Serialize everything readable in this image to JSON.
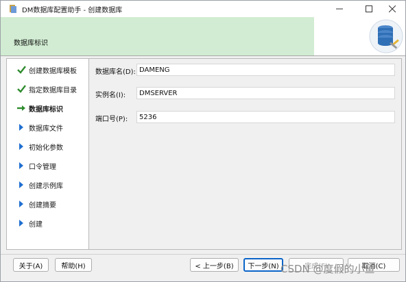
{
  "window": {
    "title": "DM数据库配置助手 - 创建数据库",
    "minimize_icon": "minimize-icon",
    "maximize_icon": "maximize-icon",
    "close_icon": "close-icon"
  },
  "header": {
    "title": "数据库标识",
    "image_icon": "database-config-icon"
  },
  "nav": {
    "items": [
      {
        "label": "创建数据库模板",
        "state": "done",
        "icon": "checkmark-icon"
      },
      {
        "label": "指定数据库目录",
        "state": "done",
        "icon": "checkmark-icon"
      },
      {
        "label": "数据库标识",
        "state": "current",
        "icon": "arrow-right-icon"
      },
      {
        "label": "数据库文件",
        "state": "pending",
        "icon": "triangle-right-icon"
      },
      {
        "label": "初始化参数",
        "state": "pending",
        "icon": "triangle-right-icon"
      },
      {
        "label": "口令管理",
        "state": "pending",
        "icon": "triangle-right-icon"
      },
      {
        "label": "创建示例库",
        "state": "pending",
        "icon": "triangle-right-icon"
      },
      {
        "label": "创建摘要",
        "state": "pending",
        "icon": "triangle-right-icon"
      },
      {
        "label": "创建",
        "state": "pending",
        "icon": "triangle-right-icon"
      }
    ]
  },
  "form": {
    "db_name_label": "数据库名(D):",
    "db_name_value": "DAMENG",
    "instance_label": "实例名(I):",
    "instance_value": "DMSERVER",
    "port_label": "端口号(P):",
    "port_value": "5236"
  },
  "buttons": {
    "about": "关于(A)",
    "help": "帮助(H)",
    "prev": "< 上一步(B)",
    "next": "下一步(N)",
    "finish": "完成(F)",
    "cancel": "取消(C)"
  },
  "watermark": "CSDN @度假的小鱼",
  "colors": {
    "header_bg": "#d1ecd2",
    "check_green": "#2e8b2e",
    "arrow_green": "#2e8b2e",
    "triangle_blue": "#1f6fd1",
    "focus_blue": "#0a64c8"
  }
}
